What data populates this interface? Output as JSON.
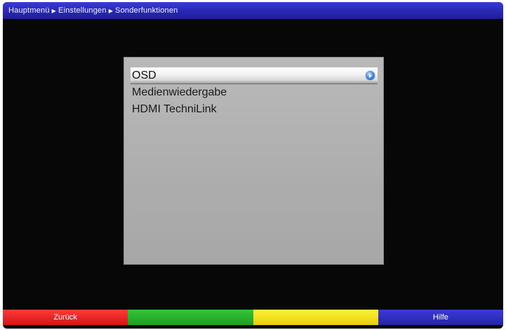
{
  "breadcrumb": {
    "items": [
      "Hauptmenü",
      "Einstellungen",
      "Sonderfunktionen"
    ],
    "separator_icon": "triangle-right-icon"
  },
  "menu": {
    "items": [
      {
        "label": "OSD",
        "selected": true
      },
      {
        "label": "Medienwiedergabe",
        "selected": false
      },
      {
        "label": "HDMI TechniLink",
        "selected": false
      }
    ],
    "selected_indicator_icon": "blue-arrow-right-icon"
  },
  "colorkeys": {
    "red": {
      "label": "Zurück",
      "color": "#e02020"
    },
    "green": {
      "label": "",
      "color": "#28ad2d"
    },
    "yellow": {
      "label": "",
      "color": "#f2e020"
    },
    "blue": {
      "label": "Hilfe",
      "color": "#2e2ec0"
    }
  },
  "colors": {
    "background": "#070707",
    "header": "#2a2ab8",
    "panel": "#adadad"
  }
}
